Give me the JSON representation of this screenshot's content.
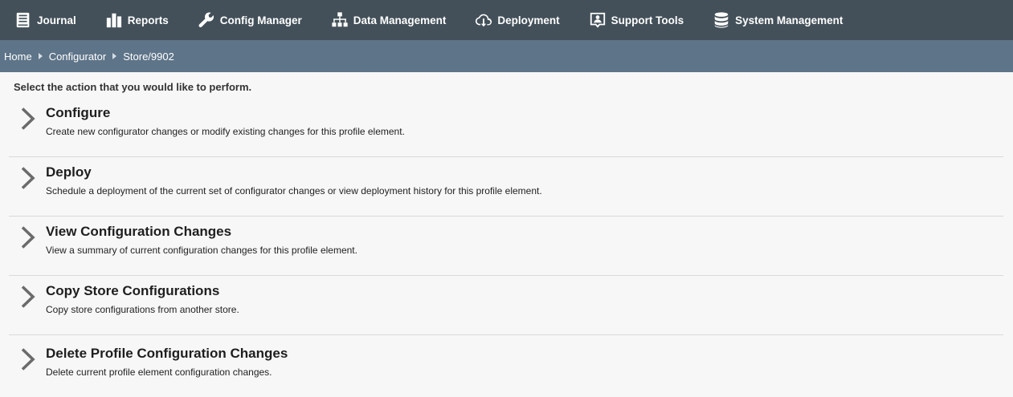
{
  "nav": {
    "items": [
      {
        "label": "Journal",
        "icon": "journal-icon"
      },
      {
        "label": "Reports",
        "icon": "bar-chart-icon"
      },
      {
        "label": "Config Manager",
        "icon": "wrench-icon"
      },
      {
        "label": "Data Management",
        "icon": "hierarchy-icon"
      },
      {
        "label": "Deployment",
        "icon": "cloud-download-icon"
      },
      {
        "label": "Support Tools",
        "icon": "support-person-icon"
      },
      {
        "label": "System Management",
        "icon": "database-icon"
      }
    ]
  },
  "breadcrumb": {
    "items": [
      "Home",
      "Configurator",
      "Store/9902"
    ]
  },
  "main": {
    "instruction": "Select the action that you would like to perform.",
    "actions": [
      {
        "title": "Configure",
        "description": "Create new configurator changes or modify existing changes for this profile element."
      },
      {
        "title": "Deploy",
        "description": "Schedule a deployment of the current set of configurator changes or view deployment history for this profile element."
      },
      {
        "title": "View Configuration Changes",
        "description": "View a summary of current configuration changes for this profile element."
      },
      {
        "title": "Copy Store Configurations",
        "description": "Copy store configurations from another store."
      },
      {
        "title": "Delete Profile Configuration Changes",
        "description": "Delete current profile element configuration changes."
      }
    ]
  },
  "colors": {
    "topnav_bg": "#435059",
    "breadcrumb_bg": "#5e7488",
    "page_bg": "#f7f7f7",
    "chevron": "#6b6b6b"
  }
}
